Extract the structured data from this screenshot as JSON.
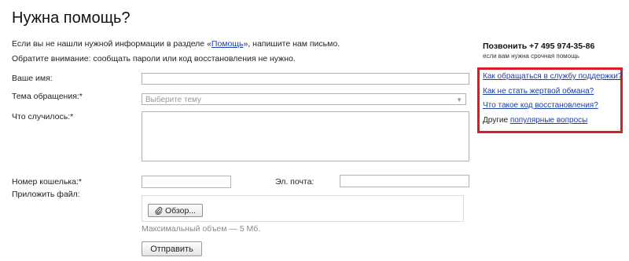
{
  "page": {
    "title": "Нужна помощь?"
  },
  "intro": {
    "line1_before": "Если вы не нашли нужной информации в разделе «",
    "line1_link": "Помощь",
    "line1_after": "», напишите нам письмо.",
    "line2": "Обратите внимание: сообщать пароли или код восстановления не нужно."
  },
  "form": {
    "name_label": "Ваше имя:",
    "name_value": "",
    "topic_label": "Тема обращения:*",
    "topic_selected": "Выберите тему",
    "what_label": "Что случилось:*",
    "what_value": "",
    "wallet_label": "Номер кошелька:*",
    "wallet_value": "",
    "email_label": "Эл. почта:",
    "email_value": "",
    "attach_label": "Приложить файл:",
    "browse_label": "Обзор...",
    "max_size_hint": "Максимальный объем — 5 Мб.",
    "submit_label": "Отправить"
  },
  "sidebar": {
    "phone": "Позвонить +7 495 974-35-86",
    "phone_note": "если вам нужна срочная помощь",
    "faq_links": [
      "Как обращаться в службу поддержки?",
      "Как не стать жертвой обмана?",
      "Что такое код восстановления?"
    ],
    "other_prefix": "Другие",
    "other_link": "популярные вопросы"
  },
  "colors": {
    "link": "#1a3fa8",
    "highlight_border": "#d81e25"
  },
  "icons": {
    "browse": "paperclip-icon",
    "select": "chevron-down-icon"
  }
}
